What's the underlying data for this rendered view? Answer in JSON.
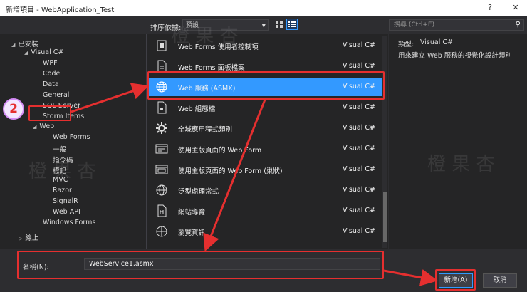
{
  "window": {
    "title": "新增項目 - WebApplication_Test",
    "help_label": "?",
    "close_label": "✕"
  },
  "toolbar": {
    "sort_label": "排序依據:",
    "sort_value": "預設",
    "search_placeholder": "搜尋 (Ctrl+E)"
  },
  "tree": {
    "installed": "已安裝",
    "items": [
      {
        "label": "Visual C#",
        "arrow": "◢"
      },
      {
        "label": "WPF"
      },
      {
        "label": "Code"
      },
      {
        "label": "Data"
      },
      {
        "label": "General"
      },
      {
        "label": "SQL Server"
      },
      {
        "label": "Storm Items"
      },
      {
        "label": "Web",
        "arrow": "◢"
      },
      {
        "label": "Web Forms"
      },
      {
        "label": "一般"
      },
      {
        "label": "指令碼"
      },
      {
        "label": "標記"
      },
      {
        "label": "MVC"
      },
      {
        "label": "Razor"
      },
      {
        "label": "SignalR"
      },
      {
        "label": "Web API"
      },
      {
        "label": "Windows Forms"
      }
    ],
    "online": "線上"
  },
  "templates": [
    {
      "name": "Web Forms 使用者控制項",
      "lang": "Visual C#",
      "icon": "user-control-icon"
    },
    {
      "name": "Web Forms 面板檔案",
      "lang": "Visual C#",
      "icon": "skin-file-icon"
    },
    {
      "name": "Web 服務 (ASMX)",
      "lang": "Visual C#",
      "icon": "globe-icon",
      "selected": true
    },
    {
      "name": "Web 組態檔",
      "lang": "Visual C#",
      "icon": "config-file-icon"
    },
    {
      "name": "全域應用程式類別",
      "lang": "Visual C#",
      "icon": "gear-icon"
    },
    {
      "name": "使用主版頁面的 Web Form",
      "lang": "Visual C#",
      "icon": "webform-icon"
    },
    {
      "name": "使用主版頁面的 Web Form (巢狀)",
      "lang": "Visual C#",
      "icon": "webform-nested-icon"
    },
    {
      "name": "泛型處理常式",
      "lang": "Visual C#",
      "icon": "handler-icon"
    },
    {
      "name": "網站導覽",
      "lang": "Visual C#",
      "icon": "sitemap-icon"
    },
    {
      "name": "瀏覽資訊",
      "lang": "Visual C#",
      "icon": "browser-file-icon"
    }
  ],
  "details": {
    "type_label": "類型:",
    "type_value": "Visual C#",
    "description": "用來建立 Web 服務的視覺化設計類別"
  },
  "name_field": {
    "label": "名稱(N):",
    "value": "WebService1.asmx"
  },
  "buttons": {
    "add": "新增(A)",
    "cancel": "取消"
  },
  "annotation": {
    "step": "2"
  },
  "watermark": "橙 果 杏",
  "colors": {
    "highlight": "#e52f2f",
    "selection": "#3399ff",
    "background": "#2d2d30"
  }
}
